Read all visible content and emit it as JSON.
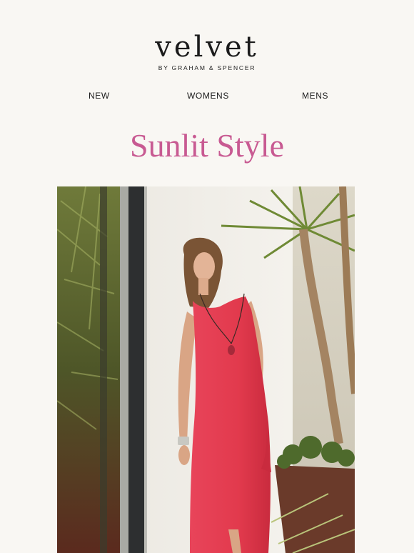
{
  "brand": {
    "logo_text": "velvet",
    "tagline": "BY GRAHAM & SPENCER"
  },
  "nav": {
    "items": [
      {
        "label": "NEW"
      },
      {
        "label": "WOMENS"
      },
      {
        "label": "MENS"
      }
    ]
  },
  "headline": "Sunlit Style",
  "colors": {
    "background": "#f9f7f3",
    "headline": "#c85a92",
    "dress": "#e23a4d"
  }
}
